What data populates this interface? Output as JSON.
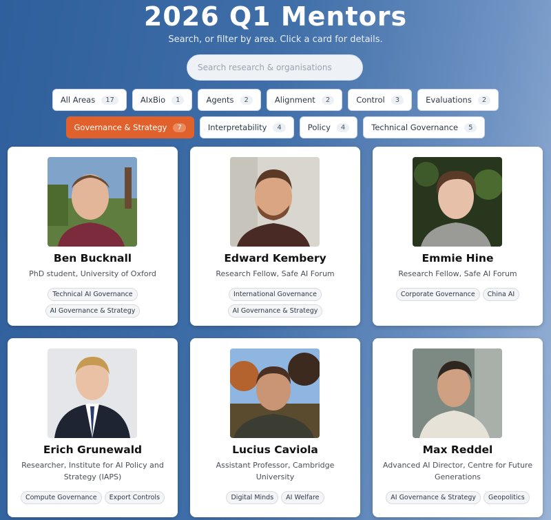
{
  "header": {
    "title": "2026 Q1 Mentors",
    "subtitle": "Search, or filter by area. Click a card for details."
  },
  "search": {
    "placeholder": "Search research & organisations"
  },
  "filters": [
    {
      "label": "All Areas",
      "count": "17"
    },
    {
      "label": "AIxBio",
      "count": "1"
    },
    {
      "label": "Agents",
      "count": "2"
    },
    {
      "label": "Alignment",
      "count": "2"
    },
    {
      "label": "Control",
      "count": "3"
    },
    {
      "label": "Evaluations",
      "count": "2"
    },
    {
      "label": "Governance & Strategy",
      "count": "7",
      "active": true
    },
    {
      "label": "Interpretability",
      "count": "4"
    },
    {
      "label": "Policy",
      "count": "4"
    },
    {
      "label": "Technical Governance",
      "count": "5"
    }
  ],
  "colors": {
    "accent": "#e0612b",
    "background": "#3f6ea8",
    "card": "#ffffff"
  },
  "mentors": [
    {
      "name": "Ben Bucknall",
      "role": "PhD student, University of Oxford",
      "tags": [
        "Technical AI Governance",
        "AI Governance & Strategy"
      ],
      "photo_icon": "portrait-photo"
    },
    {
      "name": "Edward Kembery",
      "role": "Research Fellow, Safe AI Forum",
      "tags": [
        "International Governance",
        "AI Governance & Strategy"
      ],
      "photo_icon": "portrait-photo"
    },
    {
      "name": "Emmie Hine",
      "role": "Research Fellow, Safe AI Forum",
      "tags": [
        "Corporate Governance",
        "China AI"
      ],
      "photo_icon": "portrait-photo"
    },
    {
      "name": "Erich Grunewald",
      "role": "Researcher, Institute for AI Policy and Strategy (IAPS)",
      "tags": [
        "Compute Governance",
        "Export Controls"
      ],
      "photo_icon": "portrait-photo"
    },
    {
      "name": "Lucius Caviola",
      "role": "Assistant Professor, Cambridge University",
      "tags": [
        "Digital Minds",
        "AI Welfare"
      ],
      "photo_icon": "portrait-photo"
    },
    {
      "name": "Max Reddel",
      "role": "Advanced AI Director, Centre for Future Generations",
      "tags": [
        "AI Governance & Strategy",
        "Geopolitics"
      ],
      "photo_icon": "portrait-photo"
    }
  ]
}
